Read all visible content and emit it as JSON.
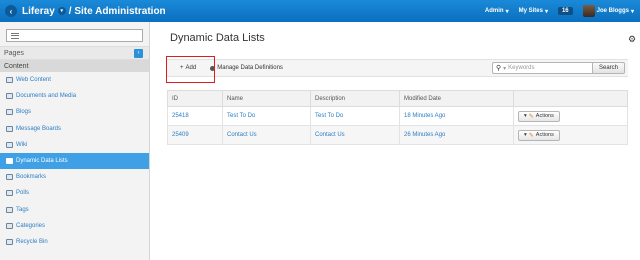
{
  "topbar": {
    "brand": "Liferay",
    "section": "/ Site Administration",
    "admin_label": "Admin",
    "my_sites_label": "My Sites",
    "notification_count": "16",
    "user_name": "Joe Bloggs"
  },
  "sidebar": {
    "search_placeholder": "",
    "pages_label": "Pages",
    "content_label": "Content",
    "items": [
      {
        "label": "Web Content"
      },
      {
        "label": "Documents and Media"
      },
      {
        "label": "Blogs"
      },
      {
        "label": "Message Boards"
      },
      {
        "label": "Wiki"
      },
      {
        "label": "Dynamic Data Lists"
      },
      {
        "label": "Bookmarks"
      },
      {
        "label": "Polls"
      },
      {
        "label": "Tags"
      },
      {
        "label": "Categories"
      },
      {
        "label": "Recycle Bin"
      }
    ],
    "active_index": 5
  },
  "main": {
    "title": "Dynamic Data Lists",
    "add_label": "Add",
    "manage_label": "Manage Data Definitions",
    "search_placeholder": "Keywords",
    "search_button": "Search",
    "columns": [
      "ID",
      "Name",
      "Description",
      "Modified Date",
      ""
    ],
    "rows": [
      {
        "id": "25418",
        "name": "Test To Do",
        "description": "Test To Do",
        "modified": "18 Minutes Ago",
        "action": "Actions"
      },
      {
        "id": "25409",
        "name": "Contact Us",
        "description": "Contact Us",
        "modified": "26 Minutes Ago",
        "action": "Actions"
      }
    ]
  },
  "colors": {
    "topbar": "#0b6fbf",
    "active_item": "#3fa0e6",
    "link": "#2d7dc4",
    "highlight_box": "#d82020"
  }
}
